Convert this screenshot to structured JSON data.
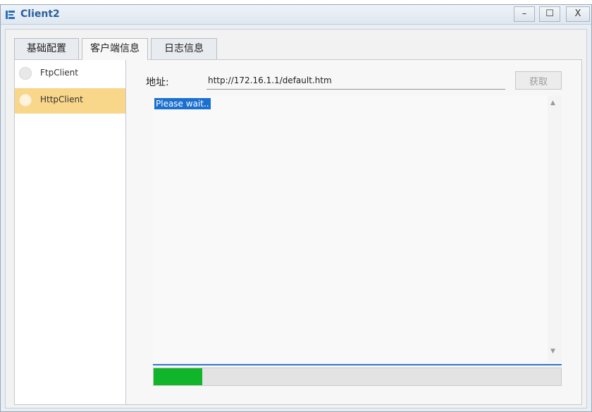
{
  "window": {
    "title": "Client2",
    "buttons": {
      "minimize": "–",
      "maximize": "☐",
      "close": "X"
    }
  },
  "tabs": [
    {
      "label": "基础配置",
      "active": false
    },
    {
      "label": "客户端信息",
      "active": true
    },
    {
      "label": "日志信息",
      "active": false
    }
  ],
  "sidebar": {
    "items": [
      {
        "label": "FtpClient",
        "selected": false
      },
      {
        "label": "HttpClient",
        "selected": true
      }
    ]
  },
  "http": {
    "address_label": "地址:",
    "address_value": "http://172.16.1.1/default.htm",
    "fetch_button": "获取",
    "content_text": "Please wait..",
    "progress_fraction": 0.12
  },
  "colors": {
    "selected_item": "#f8d68a",
    "progress_fill": "#11b52a",
    "text_selection": "#1b6fd0",
    "title_text": "#2a5f9c"
  }
}
